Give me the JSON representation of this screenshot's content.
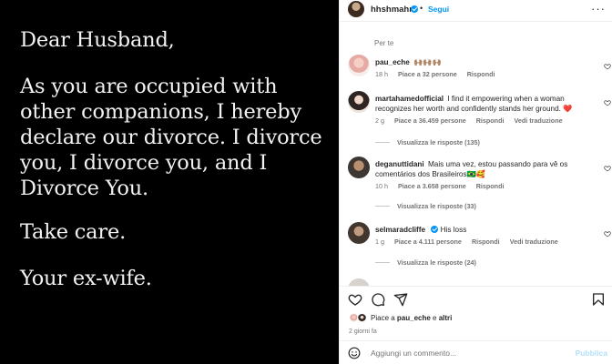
{
  "post": {
    "letter": [
      "Dear Husband,",
      "As you are occupied with other companions, I hereby declare our divorce. I divorce you, I divorce you, and I Divorce You.",
      "Take care.",
      "Your ex-wife."
    ]
  },
  "header": {
    "username": "hhshmahra",
    "separator": "•",
    "follow_label": "Segui",
    "more_label": "···"
  },
  "comments_section": {
    "for_you_label": "Per te",
    "items": [
      {
        "username": "pau_eche",
        "text": "🙌🏽🙌🏽🙌🏽",
        "time": "18 h",
        "likes": "Piace a 32 persone",
        "reply": "Rispondi",
        "translate": "",
        "view_replies": ""
      },
      {
        "username": "martahamedofficial",
        "text": "I find it empowering when a woman recognizes her worth and confidently stands her ground. ❤️",
        "time": "2 g",
        "likes": "Piace a 36.459 persone",
        "reply": "Rispondi",
        "translate": "Vedi traduzione",
        "view_replies": "Visualizza le risposte (135)"
      },
      {
        "username": "deganuttidani",
        "text": "Mais uma vez, estou passando para vê os comentários dos Brasileiros🇧🇷🥰",
        "time": "10 h",
        "likes": "Piace a 3.658 persone",
        "reply": "Rispondi",
        "translate": "",
        "view_replies": "Visualizza le risposte (33)"
      },
      {
        "username": "selmaradcliffe",
        "text": "His loss",
        "time": "1 g",
        "likes": "Piace a 4.111 persone",
        "reply": "Rispondi",
        "translate": "Vedi traduzione",
        "view_replies": "Visualizza le risposte (24)"
      }
    ]
  },
  "actions": {
    "icons": [
      "heart-icon",
      "comment-icon",
      "share-icon",
      "bookmark-icon"
    ]
  },
  "liked_by": {
    "prefix": "Piace a ",
    "user": "pau_eche",
    "middle": " e ",
    "others": "altri"
  },
  "time_ago": "2 giorni fa",
  "add_comment": {
    "placeholder": "Aggiungi un commento...",
    "publish_label": "Pubblica"
  },
  "colors": {
    "accent": "#0095f6",
    "heart_red": "#ed4956",
    "image_bg": "#000000",
    "letter_text": "#f2f2f2"
  }
}
